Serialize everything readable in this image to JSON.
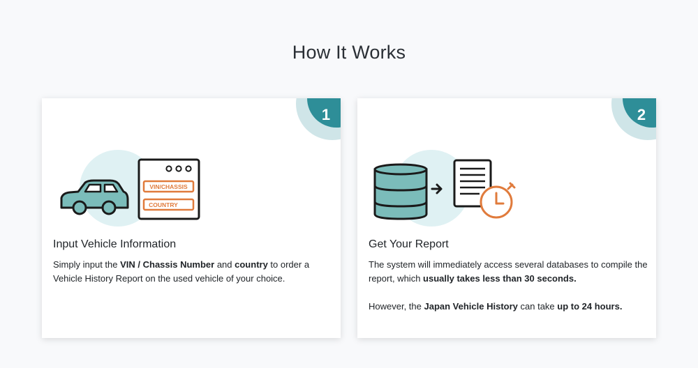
{
  "page": {
    "title": "How It Works"
  },
  "steps": [
    {
      "number": "1",
      "heading": "Input Vehicle Information",
      "illustration": {
        "icons": [
          "car-icon",
          "form-window-icon"
        ],
        "field_labels": [
          "VIN/CHASSIS",
          "COUNTRY"
        ]
      },
      "text": {
        "p1_a": "Simply input the ",
        "p1_b": "VIN / Chassis Number",
        "p1_c": " and ",
        "p1_d": "country",
        "p1_e": " to order a Vehicle History Report on the used vehicle of your choice."
      }
    },
    {
      "number": "2",
      "heading": "Get Your Report",
      "illustration": {
        "icons": [
          "database-icon",
          "arrow-right-icon",
          "document-icon",
          "stopwatch-icon"
        ]
      },
      "text": {
        "p1_a": "The system will immediately access several databases to compile the report, which ",
        "p1_b": "usually takes less than 30 seconds.",
        "p2_a": "However, the ",
        "p2_b": "Japan Vehicle History",
        "p2_c": " can take ",
        "p2_d": "up to 24 hours."
      }
    }
  ],
  "colors": {
    "teal": "#2e8e98",
    "teal_light": "#cfe5e8",
    "illus_bg": "#dff1f3",
    "icon_fill": "#7bbcba",
    "orange": "#e07b3c",
    "ink": "#1a1a1a"
  }
}
